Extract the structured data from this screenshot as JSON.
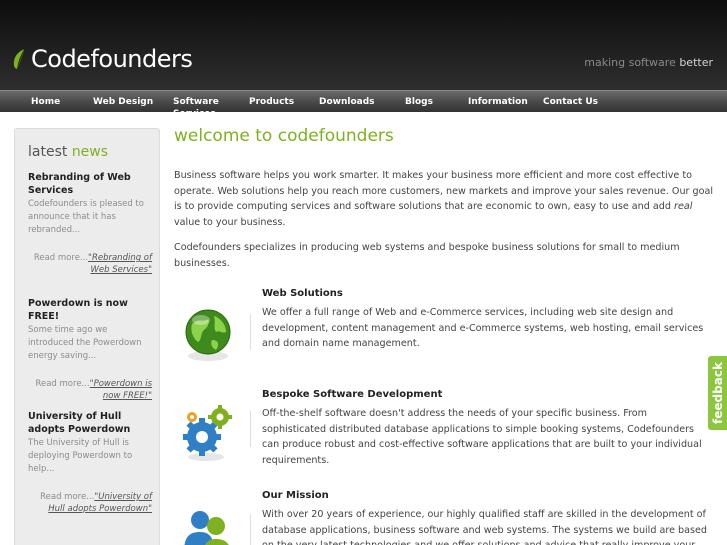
{
  "header": {
    "brand": "Codefounders",
    "tagline_dim": "making software",
    "tagline_bright": "better"
  },
  "nav": {
    "items": [
      "Home",
      "Web Design",
      "Software Services",
      "Products",
      "Downloads",
      "Blogs",
      "Information",
      "Contact Us"
    ]
  },
  "sidebar": {
    "title_plain": "latest",
    "title_accent": "news",
    "news": [
      {
        "headline": "Rebranding of Web Services",
        "summary": "Codefounders is pleased to announce that it has rebranded...",
        "more_prefix": "Read more...",
        "more_link": "\"Rebranding of Web Services\""
      },
      {
        "headline": "Powerdown is now FREE!",
        "summary": "Some time ago we introduced the Powerdown energy saving...",
        "more_prefix": "Read more...",
        "more_link": "\"Powerdown is now FREE!\""
      },
      {
        "headline": "University of Hull adopts Powerdown",
        "summary": "The University of Hull is deploying Powerdown to help...",
        "more_prefix": "Read more...",
        "more_link": "\"University of Hull adopts Powerdown\""
      }
    ]
  },
  "main": {
    "heading": "welcome to codefounders",
    "intro_before": "Business software helps you work smarter. It makes your business more efficient and more cost effective to operate. Web solutions help you reach more customers, new markets and improve your sales revenue. Our goal is to provide computing services and software solutions that are economic to own, easy to use and add ",
    "intro_emph": "real",
    "intro_after": " value to your business.",
    "intro2": "Codefounders specializes in producing web systems and bespoke business solutions for small to medium businesses.",
    "services": [
      {
        "title": "Web Solutions",
        "icon": "globe-icon",
        "text": "We offer a full range of Web and e-Commerce services, including web site design and development, content management and e-Commerce systems, web hosting, email services and domain name management."
      },
      {
        "title": "Bespoke Software Development",
        "icon": "gears-icon",
        "text": "Off-the-shelf software doesn't address the needs of your specific business. From sophisticated distributed database applications to simple booking systems, Codefounders can produce robust and cost-effective software applications that are built to your individual requirements."
      },
      {
        "title": "Our Mission",
        "icon": "people-icon",
        "text": "With over 20 years of experience, our highly qualified staff are skilled in the development of database applications, business software and web systems. The systems we build are based on the very latest technologies and we offer solutions and advice that really improve your business."
      }
    ]
  },
  "feedback_tab": "feedback",
  "colors": {
    "accent_green": "#7fb020",
    "feedback_green": "#8cc63f",
    "header_dark": "#1c1c1c"
  }
}
